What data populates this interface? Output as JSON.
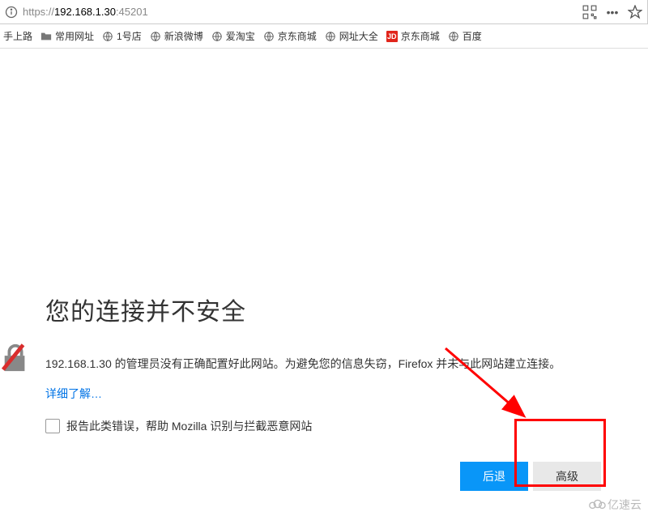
{
  "url": {
    "protocol": "https://",
    "host": "192.168.1.30",
    "port": ":45201"
  },
  "bookmarks": [
    {
      "label": "手上路",
      "icon": "none"
    },
    {
      "label": "常用网址",
      "icon": "folder"
    },
    {
      "label": "1号店",
      "icon": "globe"
    },
    {
      "label": "新浪微博",
      "icon": "globe"
    },
    {
      "label": "爱淘宝",
      "icon": "globe"
    },
    {
      "label": "京东商城",
      "icon": "globe"
    },
    {
      "label": "网址大全",
      "icon": "globe"
    },
    {
      "label": "京东商城",
      "icon": "jd"
    },
    {
      "label": "百度",
      "icon": "globe"
    }
  ],
  "warning": {
    "title": "您的连接并不安全",
    "description": "192.168.1.30 的管理员没有正确配置好此网站。为避免您的信息失窃，Firefox 并未与此网站建立连接。",
    "learn_more": "详细了解…",
    "report_label": "报告此类错误，帮助 Mozilla 识别与拦截恶意网站",
    "back_button": "后退",
    "advanced_button": "高级"
  },
  "watermark": {
    "text": "亿速云"
  }
}
